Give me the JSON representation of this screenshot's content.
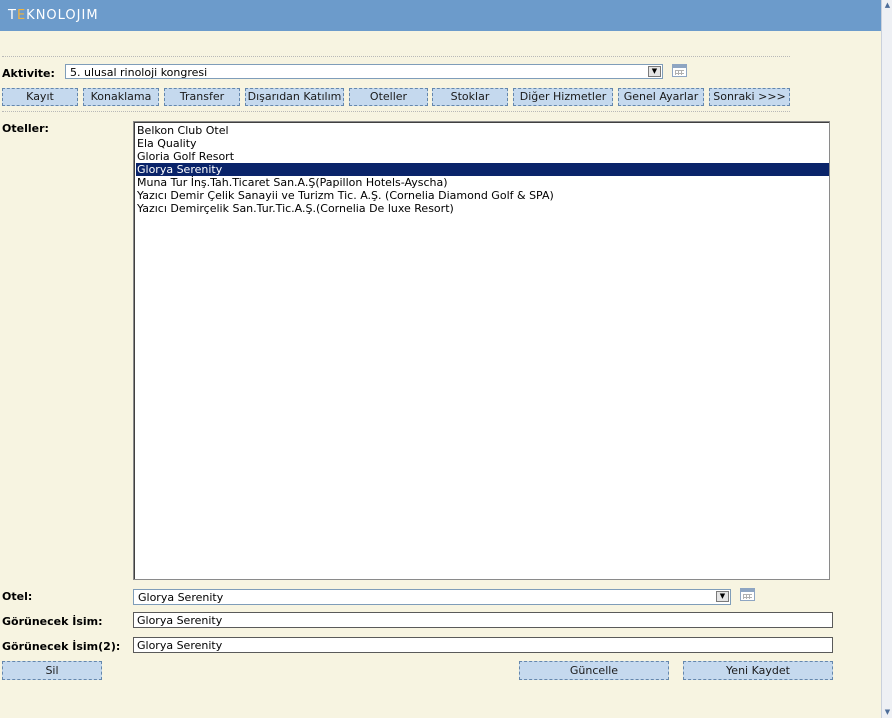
{
  "header": {
    "logo_text_a": "T",
    "logo_text_b": "E",
    "logo_text_c": "KNOLOJIM"
  },
  "activity": {
    "label": "Aktivite:",
    "value": "5. ulusal rinoloji kongresi"
  },
  "nav": {
    "buttons": [
      "Kayıt",
      "Konaklama",
      "Transfer",
      "Dışarıdan Katılım",
      "Oteller",
      "Stoklar",
      "Diğer Hizmetler",
      "Genel Ayarlar",
      "Sonraki >>>"
    ]
  },
  "hotels": {
    "label": "Oteller:",
    "items": [
      "Belkon Club Otel",
      "Ela Quality",
      "Gloria Golf Resort",
      "Glorya Serenity",
      "Muna Tur İnş.Tah.Ticaret San.A.Ş(Papillon Hotels-Ayscha)",
      "Yazıcı Demir Çelik Sanayii ve Turizm Tic. A.Ş. (Cornelia Diamond Golf & SPA)",
      "Yazıcı Demirçelik San.Tur.Tic.A.Ş.(Cornelia De luxe Resort)"
    ],
    "selected_index": 3
  },
  "form": {
    "otel_label": "Otel:",
    "otel_value": "Glorya Serenity",
    "display_name_label": "Görünecek İsim:",
    "display_name_value": "Glorya Serenity",
    "display_name2_label": "Görünecek İsim(2):",
    "display_name2_value": "Glorya Serenity"
  },
  "actions": {
    "delete": "Sil",
    "update": "Güncelle",
    "save_new": "Yeni Kaydet"
  },
  "colors": {
    "header_bg": "#6c9bcb",
    "page_bg": "#f7f4e1",
    "button_bg": "#c5d9ee",
    "selection": "#0a246a",
    "logo_accent": "#f2b33d"
  }
}
